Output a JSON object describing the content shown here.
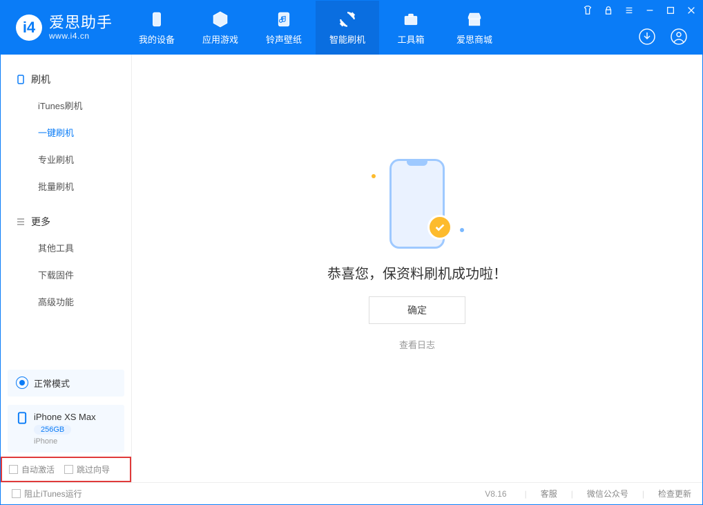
{
  "app": {
    "name": "爱思助手",
    "url": "www.i4.cn"
  },
  "nav": [
    {
      "label": "我的设备"
    },
    {
      "label": "应用游戏"
    },
    {
      "label": "铃声壁纸"
    },
    {
      "label": "智能刷机"
    },
    {
      "label": "工具箱"
    },
    {
      "label": "爱思商城"
    }
  ],
  "sidebar": {
    "group1": {
      "title": "刷机",
      "items": [
        "iTunes刷机",
        "一键刷机",
        "专业刷机",
        "批量刷机"
      ]
    },
    "group2": {
      "title": "更多",
      "items": [
        "其他工具",
        "下载固件",
        "高级功能"
      ]
    }
  },
  "mode_label": "正常模式",
  "device": {
    "name": "iPhone XS Max",
    "storage": "256GB",
    "type": "iPhone"
  },
  "bottom_options": {
    "auto_activate": "自动激活",
    "skip_guide": "跳过向导"
  },
  "main": {
    "message": "恭喜您，保资料刷机成功啦！",
    "ok": "确定",
    "view_log": "查看日志"
  },
  "statusbar": {
    "block_itunes": "阻止iTunes运行",
    "version": "V8.16",
    "links": [
      "客服",
      "微信公众号",
      "检查更新"
    ]
  }
}
